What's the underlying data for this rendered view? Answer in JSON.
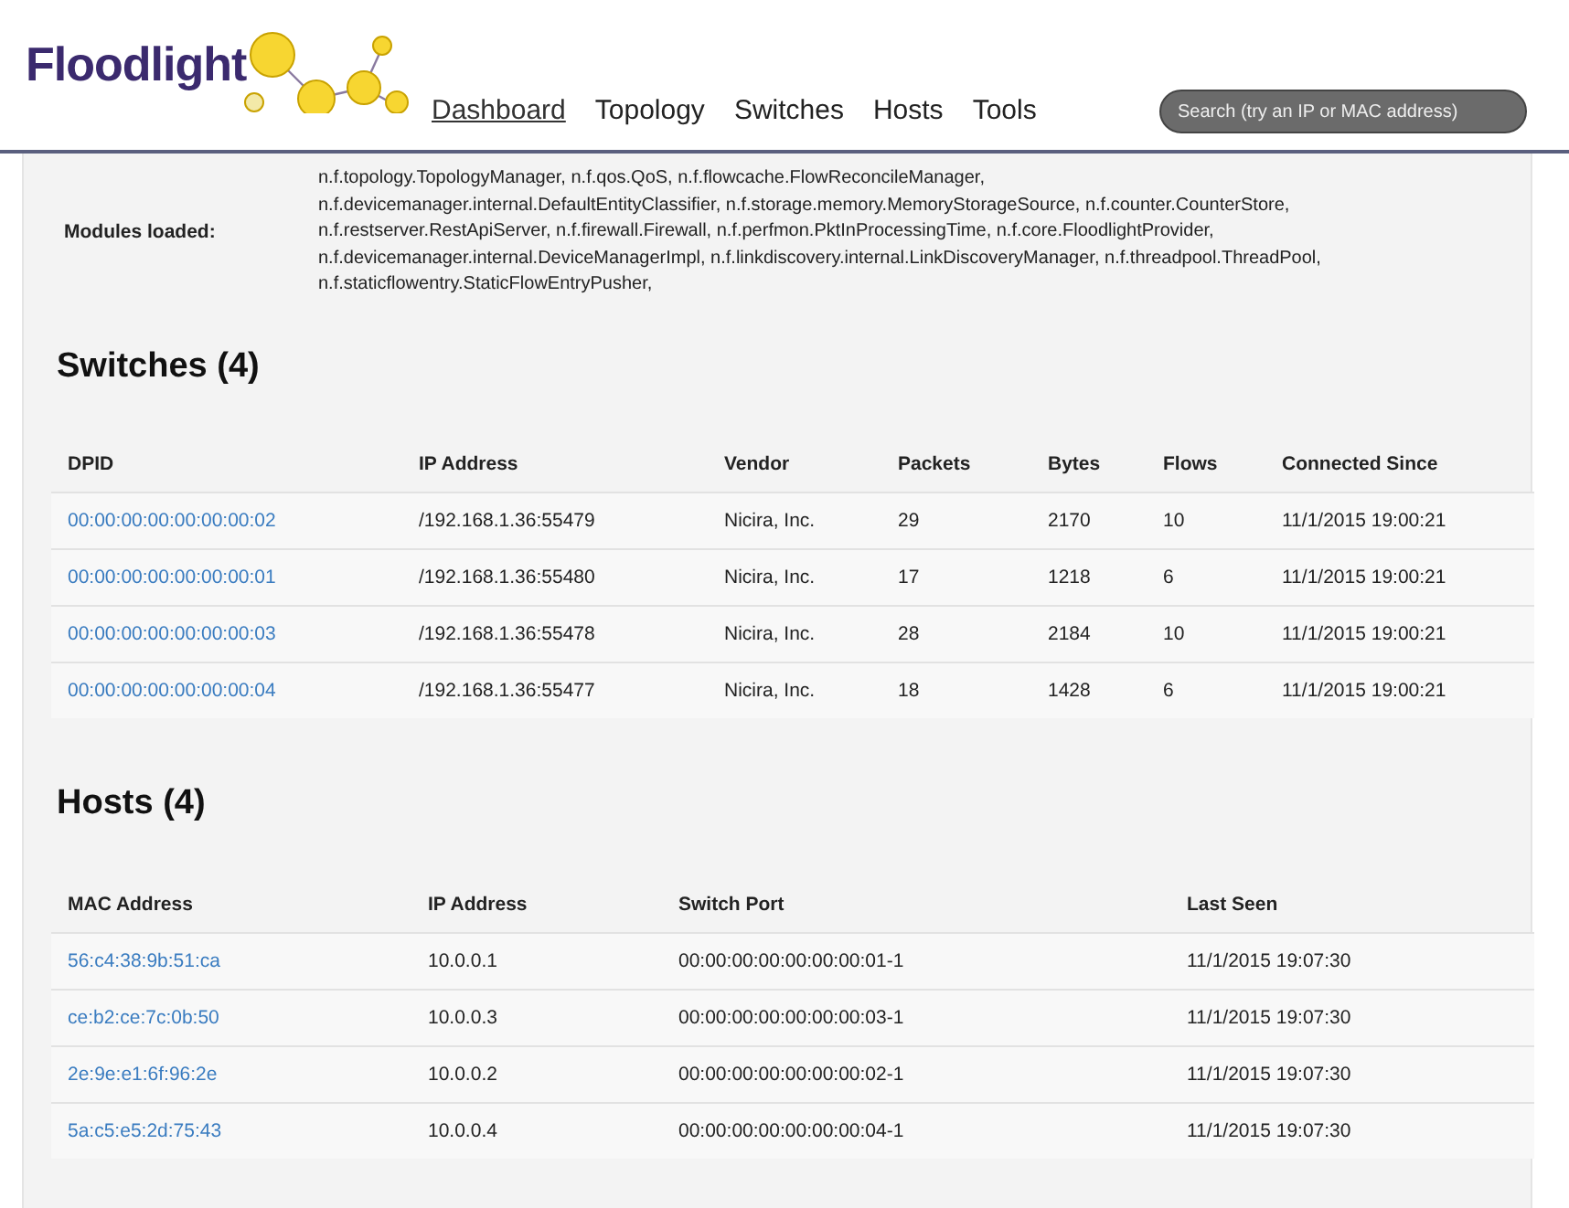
{
  "header": {
    "logo": "Floodlight",
    "nav": [
      {
        "label": "Dashboard",
        "selected": true
      },
      {
        "label": "Topology",
        "selected": false
      },
      {
        "label": "Switches",
        "selected": false
      },
      {
        "label": "Hosts",
        "selected": false
      },
      {
        "label": "Tools",
        "selected": false
      }
    ],
    "search": {
      "placeholder": "Search (try an IP or MAC address)"
    }
  },
  "modules": {
    "label": "Modules loaded:",
    "lines": [
      "n.f.topology.TopologyManager, n.f.qos.QoS, n.f.flowcache.FlowReconcileManager,",
      "n.f.devicemanager.internal.DefaultEntityClassifier, n.f.storage.memory.MemoryStorageSource, n.f.counter.CounterStore,",
      "n.f.restserver.RestApiServer, n.f.firewall.Firewall, n.f.perfmon.PktInProcessingTime, n.f.core.FloodlightProvider,",
      "n.f.devicemanager.internal.DeviceManagerImpl, n.f.linkdiscovery.internal.LinkDiscoveryManager, n.f.threadpool.ThreadPool,",
      "n.f.staticflowentry.StaticFlowEntryPusher,"
    ]
  },
  "sections": [
    {
      "title": "Switches (4)",
      "columns": [
        "DPID",
        "IP Address",
        "Vendor",
        "Packets",
        "Bytes",
        "Flows",
        "Connected Since"
      ],
      "rows": [
        [
          "00:00:00:00:00:00:00:02",
          "/192.168.1.36:55479",
          "Nicira, Inc.",
          "29",
          "2170",
          "10",
          "11/1/2015 19:00:21"
        ],
        [
          "00:00:00:00:00:00:00:01",
          "/192.168.1.36:55480",
          "Nicira, Inc.",
          "17",
          "1218",
          "6",
          "11/1/2015 19:00:21"
        ],
        [
          "00:00:00:00:00:00:00:03",
          "/192.168.1.36:55478",
          "Nicira, Inc.",
          "28",
          "2184",
          "10",
          "11/1/2015 19:00:21"
        ],
        [
          "00:00:00:00:00:00:00:04",
          "/192.168.1.36:55477",
          "Nicira, Inc.",
          "18",
          "1428",
          "6",
          "11/1/2015 19:00:21"
        ]
      ]
    },
    {
      "title": "Hosts (4)",
      "columns": [
        "MAC Address",
        "IP Address",
        "Switch Port",
        "Last Seen"
      ],
      "rows": [
        [
          "56:c4:38:9b:51:ca",
          "10.0.0.1",
          "00:00:00:00:00:00:00:01-1",
          "11/1/2015 19:07:30"
        ],
        [
          "ce:b2:ce:7c:0b:50",
          "10.0.0.3",
          "00:00:00:00:00:00:00:03-1",
          "11/1/2015 19:07:30"
        ],
        [
          "2e:9e:e1:6f:96:2e",
          "10.0.0.2",
          "00:00:00:00:00:00:00:02-1",
          "11/1/2015 19:07:30"
        ],
        [
          "5a:c5:e5:2d:75:43",
          "10.0.0.4",
          "00:00:00:00:00:00:00:04-1",
          "11/1/2015 19:07:30"
        ]
      ]
    }
  ]
}
